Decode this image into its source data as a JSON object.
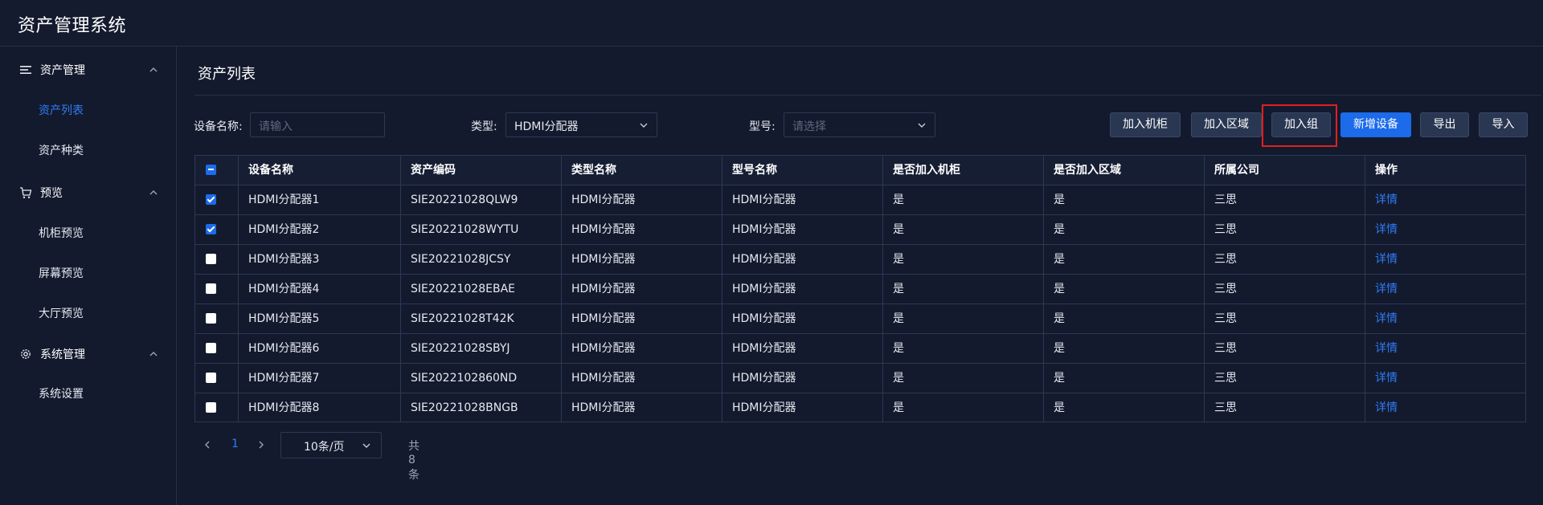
{
  "app": {
    "title": "资产管理系统"
  },
  "sidebar": {
    "groups": [
      {
        "label": "资产管理",
        "icon": "list-icon",
        "items": [
          {
            "label": "资产列表",
            "active": true
          },
          {
            "label": "资产种类",
            "active": false
          }
        ]
      },
      {
        "label": "预览",
        "icon": "cart-icon",
        "items": [
          {
            "label": "机柜预览"
          },
          {
            "label": "屏幕预览"
          },
          {
            "label": "大厅预览"
          }
        ]
      },
      {
        "label": "系统管理",
        "icon": "gear-icon",
        "items": [
          {
            "label": "系统设置"
          }
        ]
      }
    ]
  },
  "page": {
    "title": "资产列表"
  },
  "filters": {
    "name_label": "设备名称:",
    "name_placeholder": "请输入",
    "type_label": "类型:",
    "type_value": "HDMI分配器",
    "model_label": "型号:",
    "model_placeholder": "请选择"
  },
  "toolbar": {
    "add_cabinet": "加入机柜",
    "add_area": "加入区域",
    "add_group": "加入组",
    "new_device": "新增设备",
    "export": "导出",
    "import": "导入"
  },
  "table": {
    "headers": [
      "设备名称",
      "资产编码",
      "类型名称",
      "型号名称",
      "是否加入机柜",
      "是否加入区域",
      "所属公司",
      "操作"
    ],
    "rows": [
      {
        "checked": true,
        "name": "HDMI分配器1",
        "code": "SIE20221028QLW9",
        "type": "HDMI分配器",
        "model": "HDMI分配器",
        "cabinet": "是",
        "area": "是",
        "company": "三思",
        "action": "详情"
      },
      {
        "checked": true,
        "name": "HDMI分配器2",
        "code": "SIE20221028WYTU",
        "type": "HDMI分配器",
        "model": "HDMI分配器",
        "cabinet": "是",
        "area": "是",
        "company": "三思",
        "action": "详情"
      },
      {
        "checked": false,
        "name": "HDMI分配器3",
        "code": "SIE20221028JCSY",
        "type": "HDMI分配器",
        "model": "HDMI分配器",
        "cabinet": "是",
        "area": "是",
        "company": "三思",
        "action": "详情"
      },
      {
        "checked": false,
        "name": "HDMI分配器4",
        "code": "SIE20221028EBAE",
        "type": "HDMI分配器",
        "model": "HDMI分配器",
        "cabinet": "是",
        "area": "是",
        "company": "三思",
        "action": "详情"
      },
      {
        "checked": false,
        "name": "HDMI分配器5",
        "code": "SIE20221028T42K",
        "type": "HDMI分配器",
        "model": "HDMI分配器",
        "cabinet": "是",
        "area": "是",
        "company": "三思",
        "action": "详情"
      },
      {
        "checked": false,
        "name": "HDMI分配器6",
        "code": "SIE20221028SBYJ",
        "type": "HDMI分配器",
        "model": "HDMI分配器",
        "cabinet": "是",
        "area": "是",
        "company": "三思",
        "action": "详情"
      },
      {
        "checked": false,
        "name": "HDMI分配器7",
        "code": "SIE2022102860ND",
        "type": "HDMI分配器",
        "model": "HDMI分配器",
        "cabinet": "是",
        "area": "是",
        "company": "三思",
        "action": "详情"
      },
      {
        "checked": false,
        "name": "HDMI分配器8",
        "code": "SIE20221028BNGB",
        "type": "HDMI分配器",
        "model": "HDMI分配器",
        "cabinet": "是",
        "area": "是",
        "company": "三思",
        "action": "详情"
      }
    ]
  },
  "pagination": {
    "current": "1",
    "page_size": "10条/页",
    "total": "共 8 条"
  },
  "colors": {
    "accent": "#1C6BEA",
    "link": "#2F7CF6",
    "background": "#131A2E",
    "highlight": "#E02020"
  }
}
